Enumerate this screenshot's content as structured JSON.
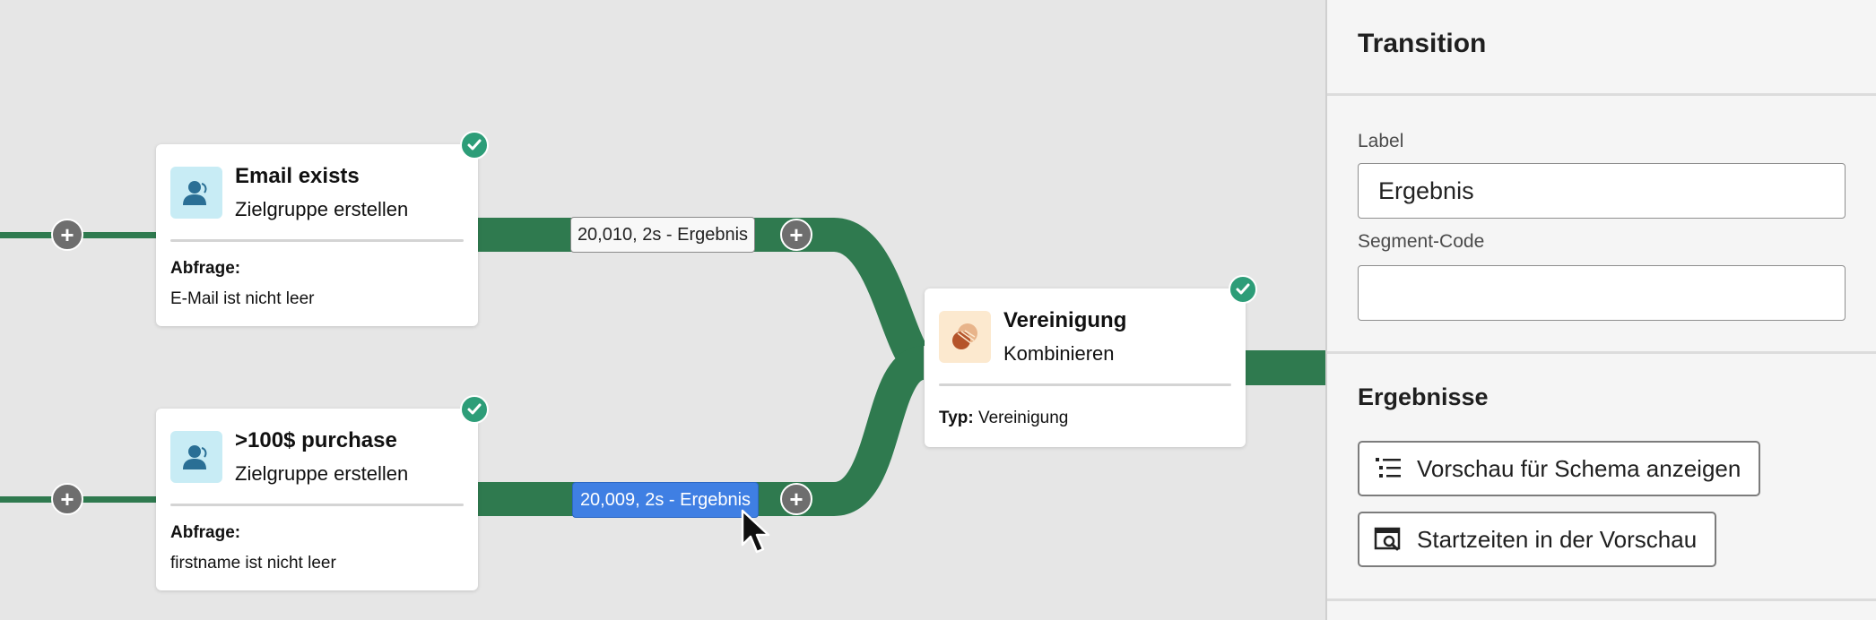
{
  "colors": {
    "flow_green": "#2f7a4f",
    "check_green": "#2d9d78",
    "selected_blue": "#3f7fe3",
    "audience_icon_bg": "#c8ecf5",
    "union_icon_bg": "#fce9cf"
  },
  "canvas": {
    "nodes": [
      {
        "title": "Email exists",
        "subtitle": "Zielgruppe erstellen",
        "query_label": "Abfrage:",
        "query_value": "E-Mail ist nicht leer",
        "icon": "audience-icon",
        "status": "check-icon"
      },
      {
        "title": ">100$ purchase",
        "subtitle": "Zielgruppe erstellen",
        "query_label": "Abfrage:",
        "query_value": "firstname ist nicht leer",
        "icon": "audience-icon",
        "status": "check-icon"
      },
      {
        "title": "Vereinigung",
        "subtitle": "Kombinieren",
        "type_label": "Typ:",
        "type_value": "Vereinigung",
        "icon": "union-icon",
        "status": "check-icon"
      }
    ],
    "transitions": [
      {
        "label": "20,010, 2s - Ergebnis",
        "selected": false
      },
      {
        "label": "20,009, 2s - Ergebnis",
        "selected": true
      }
    ],
    "add_buttons_label": "+"
  },
  "panel": {
    "title": "Transition",
    "label_field": {
      "label": "Label",
      "value": "Ergebnis"
    },
    "segment_field": {
      "label": "Segment-Code",
      "value": ""
    },
    "results_title": "Ergebnisse",
    "buttons": [
      {
        "label": "Vorschau für Schema anzeigen",
        "icon": "schema-list-icon"
      },
      {
        "label": "Startzeiten in der Vorschau",
        "icon": "preview-search-icon"
      }
    ]
  }
}
